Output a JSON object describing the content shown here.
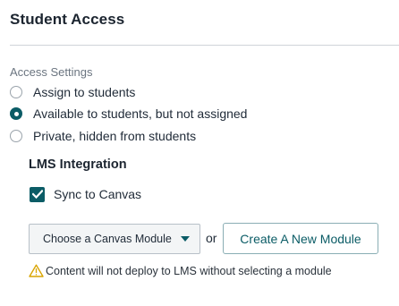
{
  "panel": {
    "title": "Student Access"
  },
  "access_settings": {
    "label": "Access Settings",
    "options": [
      {
        "label": "Assign to students",
        "selected": false
      },
      {
        "label": "Available to students, but not assigned",
        "selected": true
      },
      {
        "label": "Private, hidden from students",
        "selected": false
      }
    ]
  },
  "lms": {
    "title": "LMS Integration",
    "sync_label": "Sync to Canvas",
    "sync_checked": true,
    "module_dropdown_label": "Choose a Canvas Module",
    "or_text": "or",
    "create_button_label": "Create A New Module",
    "warning_text": "Content will not deploy to LMS without selecting a module",
    "warning_icon": "warning-triangle-icon"
  },
  "colors": {
    "accent": "#0b5c66",
    "warning": "#d9a400"
  }
}
